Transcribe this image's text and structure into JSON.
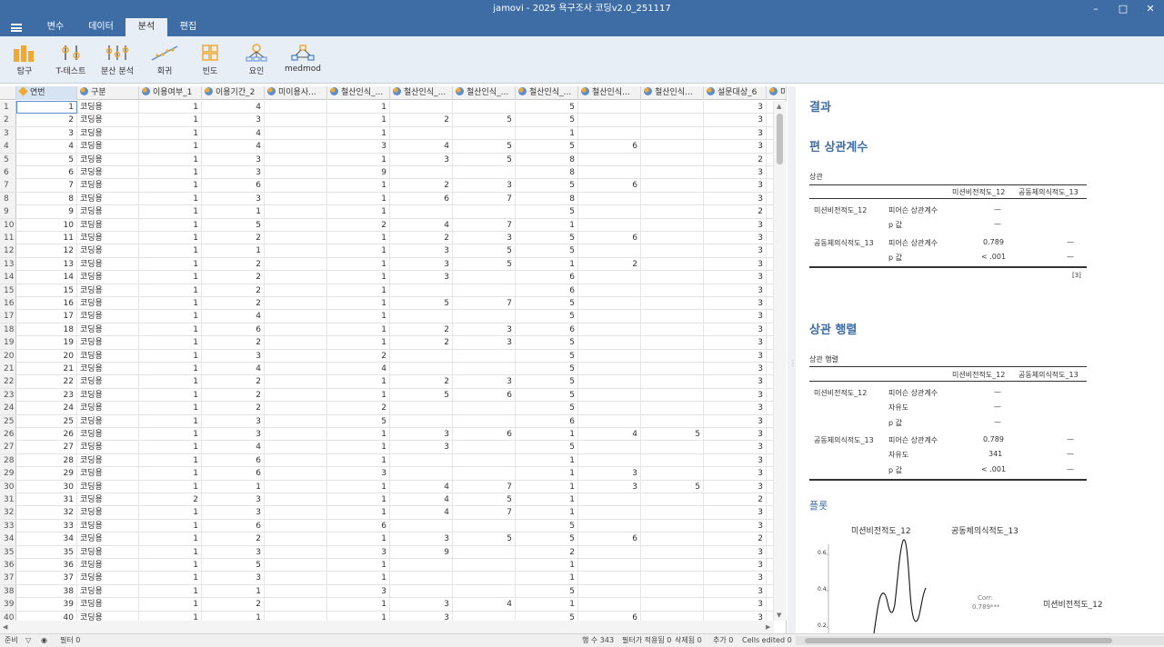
{
  "window": {
    "title": "jamovi - 2025 욕구조사 코딩v2.0_251117"
  },
  "menu": {
    "tabs": [
      "변수",
      "데이터",
      "분석",
      "편집"
    ],
    "active": "분석"
  },
  "ribbon": {
    "buttons": [
      "탐구",
      "T-테스트",
      "분산 분석",
      "회귀",
      "빈도",
      "요인",
      "medmod"
    ]
  },
  "columns": [
    {
      "name": "연번",
      "type": "id"
    },
    {
      "name": "구분",
      "type": "nominal"
    },
    {
      "name": "이용여부_1",
      "type": "nominal"
    },
    {
      "name": "이용기간_2",
      "type": "nominal"
    },
    {
      "name": "미이용사...",
      "type": "nominal"
    },
    {
      "name": "철산인식_...",
      "type": "nominal"
    },
    {
      "name": "철산인식_...",
      "type": "nominal"
    },
    {
      "name": "철산인식_...",
      "type": "nominal"
    },
    {
      "name": "철산인식_...",
      "type": "nominal"
    },
    {
      "name": "철산인식...",
      "type": "nominal"
    },
    {
      "name": "철산인식...",
      "type": "nominal"
    },
    {
      "name": "설문대상_6",
      "type": "nominal"
    },
    {
      "name": "미",
      "type": "nominal"
    }
  ],
  "rows": [
    [
      "1",
      "코딩용",
      "1",
      "4",
      "",
      "1",
      "",
      "",
      "5",
      "",
      "",
      "3"
    ],
    [
      "2",
      "코딩용",
      "1",
      "3",
      "",
      "1",
      "2",
      "5",
      "5",
      "",
      "",
      "3"
    ],
    [
      "3",
      "코딩용",
      "1",
      "4",
      "",
      "1",
      "",
      "",
      "1",
      "",
      "",
      "3"
    ],
    [
      "4",
      "코딩용",
      "1",
      "4",
      "",
      "3",
      "4",
      "5",
      "5",
      "6",
      "",
      "3"
    ],
    [
      "5",
      "코딩용",
      "1",
      "3",
      "",
      "1",
      "3",
      "5",
      "8",
      "",
      "",
      "2"
    ],
    [
      "6",
      "코딩용",
      "1",
      "3",
      "",
      "9",
      "",
      "",
      "8",
      "",
      "",
      "3"
    ],
    [
      "7",
      "코딩용",
      "1",
      "6",
      "",
      "1",
      "2",
      "3",
      "5",
      "6",
      "",
      "3"
    ],
    [
      "8",
      "코딩용",
      "1",
      "3",
      "",
      "1",
      "6",
      "7",
      "8",
      "",
      "",
      "3"
    ],
    [
      "9",
      "코딩용",
      "1",
      "1",
      "",
      "1",
      "",
      "",
      "5",
      "",
      "",
      "2"
    ],
    [
      "10",
      "코딩용",
      "1",
      "5",
      "",
      "2",
      "4",
      "7",
      "1",
      "",
      "",
      "3"
    ],
    [
      "11",
      "코딩용",
      "1",
      "2",
      "",
      "1",
      "2",
      "3",
      "5",
      "6",
      "",
      "3"
    ],
    [
      "12",
      "코딩용",
      "1",
      "1",
      "",
      "1",
      "3",
      "5",
      "5",
      "",
      "",
      "3"
    ],
    [
      "13",
      "코딩용",
      "1",
      "2",
      "",
      "1",
      "3",
      "5",
      "1",
      "2",
      "",
      "3"
    ],
    [
      "14",
      "코딩용",
      "1",
      "2",
      "",
      "1",
      "3",
      "",
      "6",
      "",
      "",
      "3"
    ],
    [
      "15",
      "코딩용",
      "1",
      "2",
      "",
      "1",
      "",
      "",
      "6",
      "",
      "",
      "3"
    ],
    [
      "16",
      "코딩용",
      "1",
      "2",
      "",
      "1",
      "5",
      "7",
      "5",
      "",
      "",
      "3"
    ],
    [
      "17",
      "코딩용",
      "1",
      "4",
      "",
      "1",
      "",
      "",
      "5",
      "",
      "",
      "3"
    ],
    [
      "18",
      "코딩용",
      "1",
      "6",
      "",
      "1",
      "2",
      "3",
      "6",
      "",
      "",
      "3"
    ],
    [
      "19",
      "코딩용",
      "1",
      "2",
      "",
      "1",
      "2",
      "3",
      "5",
      "",
      "",
      "3"
    ],
    [
      "20",
      "코딩용",
      "1",
      "3",
      "",
      "2",
      "",
      "",
      "5",
      "",
      "",
      "3"
    ],
    [
      "21",
      "코딩용",
      "1",
      "4",
      "",
      "4",
      "",
      "",
      "5",
      "",
      "",
      "3"
    ],
    [
      "22",
      "코딩용",
      "1",
      "2",
      "",
      "1",
      "2",
      "3",
      "5",
      "",
      "",
      "3"
    ],
    [
      "23",
      "코딩용",
      "1",
      "2",
      "",
      "1",
      "5",
      "6",
      "5",
      "",
      "",
      "3"
    ],
    [
      "24",
      "코딩용",
      "1",
      "2",
      "",
      "2",
      "",
      "",
      "5",
      "",
      "",
      "3"
    ],
    [
      "25",
      "코딩용",
      "1",
      "3",
      "",
      "5",
      "",
      "",
      "6",
      "",
      "",
      "3"
    ],
    [
      "26",
      "코딩용",
      "1",
      "3",
      "",
      "1",
      "3",
      "6",
      "1",
      "4",
      "5",
      "3"
    ],
    [
      "27",
      "코딩용",
      "1",
      "4",
      "",
      "1",
      "3",
      "",
      "5",
      "",
      "",
      "3"
    ],
    [
      "28",
      "코딩용",
      "1",
      "6",
      "",
      "1",
      "",
      "",
      "1",
      "",
      "",
      "3"
    ],
    [
      "29",
      "코딩용",
      "1",
      "6",
      "",
      "3",
      "",
      "",
      "1",
      "3",
      "",
      "3"
    ],
    [
      "30",
      "코딩용",
      "1",
      "1",
      "",
      "1",
      "4",
      "7",
      "1",
      "3",
      "5",
      "3"
    ],
    [
      "31",
      "코딩용",
      "2",
      "3",
      "",
      "1",
      "4",
      "5",
      "1",
      "",
      "",
      "2"
    ],
    [
      "32",
      "코딩용",
      "1",
      "3",
      "",
      "1",
      "4",
      "7",
      "1",
      "",
      "",
      "3"
    ],
    [
      "33",
      "코딩용",
      "1",
      "6",
      "",
      "6",
      "",
      "",
      "5",
      "",
      "",
      "3"
    ],
    [
      "34",
      "코딩용",
      "1",
      "2",
      "",
      "1",
      "3",
      "5",
      "5",
      "6",
      "",
      "2"
    ],
    [
      "35",
      "코딩용",
      "1",
      "3",
      "",
      "3",
      "9",
      "",
      "2",
      "",
      "",
      "3"
    ],
    [
      "36",
      "코딩용",
      "1",
      "5",
      "",
      "1",
      "",
      "",
      "1",
      "",
      "",
      "3"
    ],
    [
      "37",
      "코딩용",
      "1",
      "3",
      "",
      "1",
      "",
      "",
      "1",
      "",
      "",
      "3"
    ],
    [
      "38",
      "코딩용",
      "1",
      "1",
      "",
      "3",
      "",
      "",
      "5",
      "",
      "",
      "3"
    ],
    [
      "39",
      "코딩용",
      "1",
      "2",
      "",
      "1",
      "3",
      "4",
      "1",
      "",
      "",
      "3"
    ],
    [
      "40",
      "코딩용",
      "1",
      "1",
      "",
      "1",
      "3",
      "",
      "5",
      "6",
      "",
      "3"
    ]
  ],
  "results": {
    "heading": "결과",
    "partial": {
      "title": "편 상관계수",
      "table_title": "상관",
      "col1": "미션비전적도_12",
      "col2": "공동체의식적도_13",
      "row1": "미션비전적도_12",
      "row2": "공동체의식적도_13",
      "stat_r": "피어슨 상관계수",
      "stat_p": "p 값",
      "dash": "—",
      "r_value": "0.789",
      "p_value": "< .001",
      "footnote": "[3]"
    },
    "matrix": {
      "title": "상관 행렬",
      "table_title": "상관 행렬",
      "col1": "미션비전적도_12",
      "col2": "공동체의식적도_13",
      "row1": "미션비전적도_12",
      "row2": "공동체의식적도_13",
      "stat_r": "피어슨 상관계수",
      "stat_df": "자유도",
      "stat_p": "p 값",
      "dash": "—",
      "r_value": "0.789",
      "df_value": "341",
      "p_value": "< .001"
    },
    "plot": {
      "title": "플롯",
      "label_x1": "미션비전적도_12",
      "label_x2": "공동체의식적도_13",
      "corr_label": "Corr:",
      "corr_value": "0.789***",
      "row_label": "미션비전적도_12",
      "y_ticks": [
        "0.6",
        "0.4",
        "0.2"
      ]
    }
  },
  "status": {
    "ready": "준비",
    "filter": "필터 0",
    "row_count": "행 수 343",
    "filtered": "필터가 적용됨 0",
    "deleted": "삭제됨 0",
    "added": "추가 0",
    "edited": "Cells edited 0"
  },
  "colors": {
    "accent": "#3e6da6",
    "ribbon": "#e8eef6",
    "title": "#3e6da6"
  }
}
